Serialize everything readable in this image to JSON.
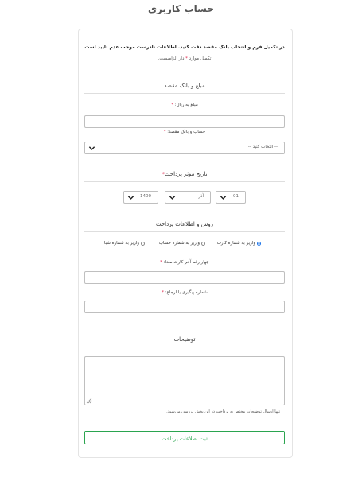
{
  "page": {
    "title": "حساب کاربری"
  },
  "notice": {
    "line1": "در تکمیل فرم و انتخاب بانک مقصد دقت کنید. اطلاعات نادرست موجب عدم تایید است",
    "line2_suffix": "تکمیل موارد",
    "line2_star": "*",
    "line2_rest": "دار الزامیست."
  },
  "amount_section": {
    "title": "مبلغ و بانک مقصد",
    "amount_label": "مبلغ به ریال:",
    "amount_value": "",
    "bank_label": "حساب و بانک مقصد:",
    "bank_selected": "-- انتخاب کنید --"
  },
  "date_section": {
    "title": "تاریخ موثر پرداخت",
    "year": "1400",
    "month": "آذر",
    "day": "01"
  },
  "payment_section": {
    "title": "روش و اطلاعات پرداخت",
    "options": [
      {
        "label": "واریز به شماره کارت",
        "checked": true
      },
      {
        "label": "واریز به شماره حساب",
        "checked": false
      },
      {
        "label": "واریز به شماره شبا",
        "checked": false
      }
    ],
    "card_digits_label": "چهار رقم آخر کارت مبدا:",
    "tracking_label": "شماره پیگیری یا ارجاع:"
  },
  "notes_section": {
    "title": "توضیحات",
    "hint": "تنها ارسال توضیحات مختص به پرداخت در این بخش بررسی می‌شود."
  },
  "submit_label": "ثبت اطلاعات پرداخت",
  "colors": {
    "required": "#e0234a",
    "submit": "#2aa44f",
    "radio": "#1a73e8"
  },
  "required_mark": "*"
}
